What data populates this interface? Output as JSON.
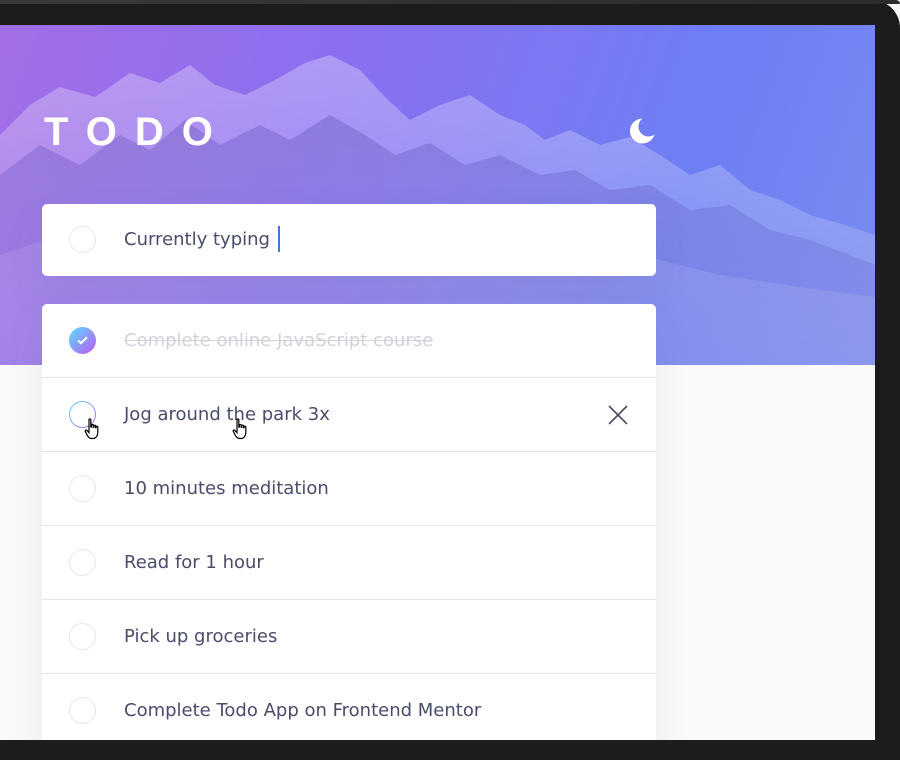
{
  "app": {
    "title": "TODO",
    "theme_toggle_icon": "moon-icon"
  },
  "new_todo": {
    "value": "Currently typing",
    "caret_visible": true
  },
  "todos": [
    {
      "text": "Complete online JavaScript course",
      "completed": true
    },
    {
      "text": "Jog around the park 3x",
      "completed": false,
      "hovered": true
    },
    {
      "text": "10 minutes meditation",
      "completed": false
    },
    {
      "text": "Read for 1 hour",
      "completed": false
    },
    {
      "text": "Pick up groceries",
      "completed": false
    },
    {
      "text": "Complete Todo App on Frontend Mentor",
      "completed": false
    }
  ],
  "icons": {
    "delete": "cross-icon",
    "check": "check-icon",
    "pointer": "hand-pointer-icon"
  },
  "colors": {
    "gradient_start": "#55ddff",
    "gradient_end": "#c058f3",
    "text": "#494c6b",
    "completed_text": "#d1d2da",
    "divider": "#e3e4f1",
    "hero_start": "#a26ee6",
    "hero_end": "#6d7ff3"
  }
}
